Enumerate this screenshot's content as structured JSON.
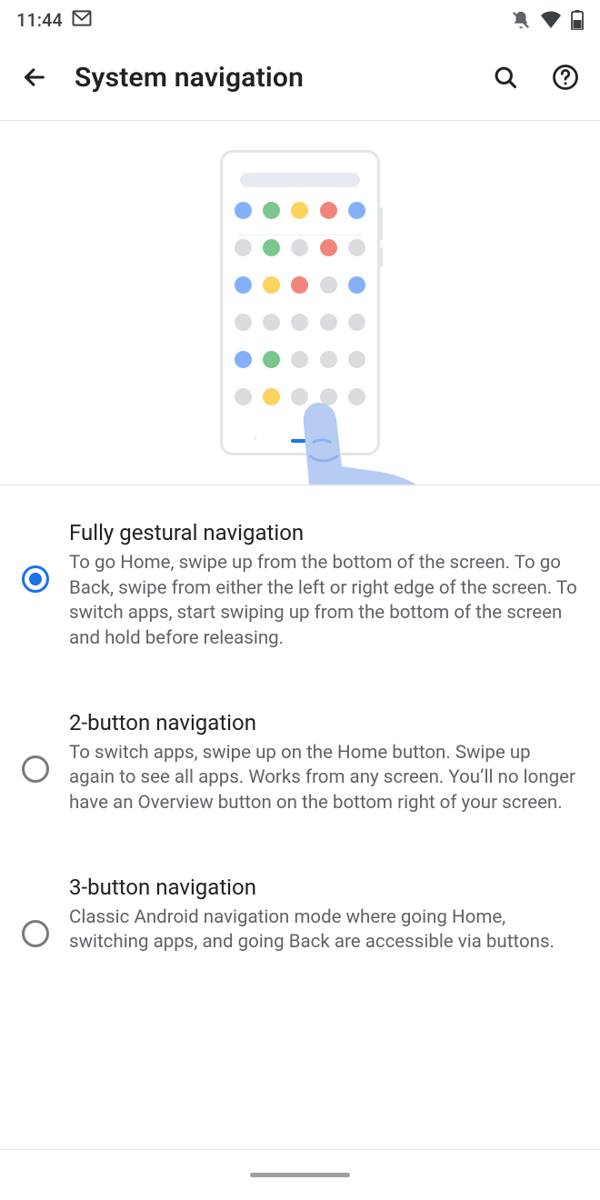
{
  "status": {
    "time": "11:44"
  },
  "header": {
    "title": "System navigation"
  },
  "options": [
    {
      "title": "Fully gestural navigation",
      "desc": "To go Home, swipe up from the bottom of the screen. To go Back, swipe from either the left or right edge of the screen. To switch apps, start swiping up from the bottom of the screen and hold before releasing.",
      "selected": true
    },
    {
      "title": "2-button navigation",
      "desc": "To switch apps, swipe up on the Home button. Swipe up again to see all apps. Works from any screen. You’ll no longer have an Overview button on the bottom right of your screen.",
      "selected": false
    },
    {
      "title": "3-button navigation",
      "desc": "Classic Android navigation mode where going Home, switching apps, and going Back are accessible via buttons.",
      "selected": false
    }
  ]
}
